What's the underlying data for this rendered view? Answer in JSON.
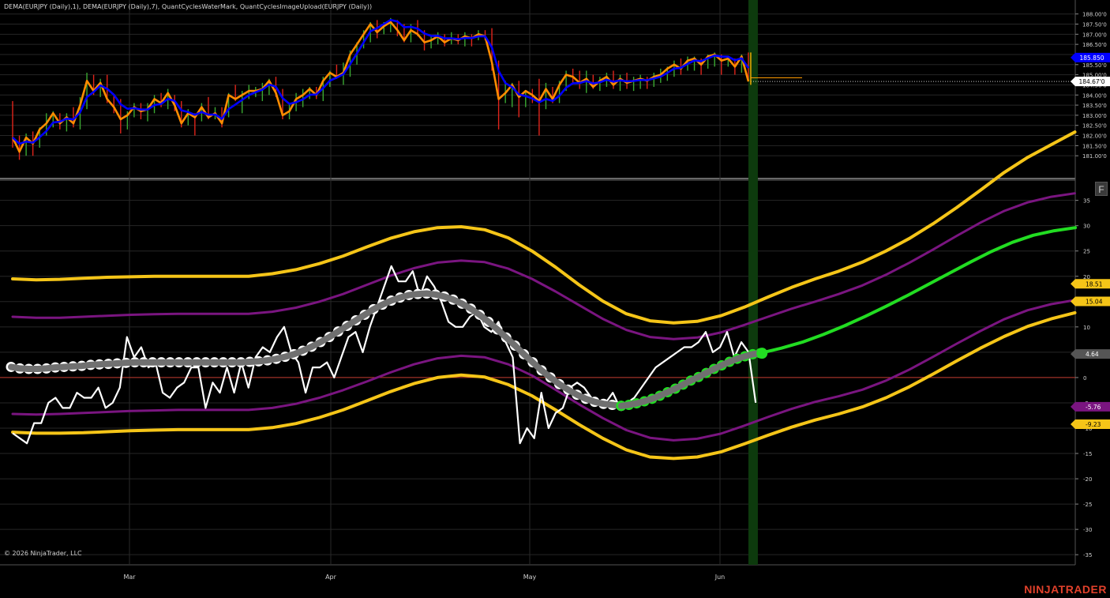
{
  "header": {
    "indicator_label": "DEMA(EURJPY (Daily),1), DEMA(EURJPY (Daily),7), QuantCyclesWaterMark, QuantCyclesImageUpload(EURJPY (Daily))"
  },
  "footer": {
    "copyright": "© 2026 NinjaTrader, LLC",
    "brand": "NINJATRADER",
    "f_button": "F"
  },
  "chart_data": [
    {
      "type": "line",
      "title": "",
      "ylim": [
        180.5,
        188.3
      ],
      "y_ticks": [
        "188.00'0",
        "187.50'0",
        "187.00'0",
        "186.50'0",
        "186.00'0",
        "185.50'0",
        "185.00'0",
        "184.50'0",
        "184.00'0",
        "183.50'0",
        "183.00'0",
        "182.50'0",
        "182.00'0",
        "181.50'0",
        "181.00'0"
      ],
      "x_ticks": [
        "Mar",
        "Apr",
        "May",
        "Jun"
      ],
      "price_bars": [
        [
          183.7,
          181.4,
          183.6,
          181.9
        ],
        [
          182.0,
          180.8,
          181.9,
          181.2
        ],
        [
          182.1,
          181.0,
          181.3,
          181.9
        ],
        [
          182.2,
          181.0,
          181.8,
          181.6
        ],
        [
          182.4,
          181.4,
          181.6,
          182.3
        ],
        [
          183.1,
          182.0,
          182.3,
          182.6
        ],
        [
          183.2,
          182.4,
          182.6,
          183.1
        ],
        [
          183.1,
          182.3,
          183.0,
          182.6
        ],
        [
          183.1,
          182.2,
          182.6,
          182.9
        ],
        [
          183.4,
          182.4,
          182.9,
          182.6
        ],
        [
          183.9,
          182.3,
          182.6,
          183.5
        ],
        [
          185.1,
          183.3,
          183.5,
          184.7
        ],
        [
          185.0,
          184.0,
          184.6,
          184.2
        ],
        [
          184.8,
          183.9,
          184.2,
          184.6
        ],
        [
          185.0,
          183.6,
          184.6,
          183.8
        ],
        [
          184.0,
          183.1,
          183.8,
          183.4
        ],
        [
          183.8,
          182.1,
          183.3,
          182.8
        ],
        [
          183.2,
          182.3,
          182.8,
          183.0
        ],
        [
          183.6,
          182.9,
          183.0,
          183.4
        ],
        [
          183.6,
          182.8,
          183.4,
          183.2
        ],
        [
          183.6,
          182.7,
          183.2,
          183.3
        ],
        [
          184.0,
          183.1,
          183.3,
          183.8
        ],
        [
          184.1,
          183.4,
          183.8,
          183.6
        ],
        [
          184.3,
          183.3,
          183.6,
          184.1
        ],
        [
          184.0,
          183.2,
          184.1,
          183.5
        ],
        [
          183.7,
          182.4,
          183.6,
          182.6
        ],
        [
          183.3,
          182.5,
          182.7,
          183.1
        ],
        [
          183.1,
          182.0,
          183.0,
          182.9
        ],
        [
          183.6,
          182.7,
          182.9,
          183.4
        ],
        [
          183.9,
          182.8,
          183.4,
          182.9
        ],
        [
          183.4,
          182.8,
          183.0,
          183.1
        ],
        [
          183.4,
          182.4,
          183.1,
          182.6
        ],
        [
          184.1,
          182.9,
          182.7,
          184.0
        ],
        [
          184.5,
          183.7,
          184.0,
          183.8
        ],
        [
          184.2,
          183.1,
          183.8,
          184.0
        ],
        [
          184.5,
          183.8,
          184.0,
          184.2
        ],
        [
          184.4,
          183.9,
          184.2,
          184.2
        ],
        [
          184.6,
          183.7,
          184.2,
          184.3
        ],
        [
          184.8,
          184.0,
          184.3,
          184.7
        ],
        [
          184.9,
          183.9,
          184.7,
          184.1
        ],
        [
          184.3,
          182.8,
          184.1,
          183.0
        ],
        [
          183.6,
          182.8,
          183.1,
          183.2
        ],
        [
          184.1,
          183.2,
          183.2,
          183.8
        ],
        [
          184.3,
          183.4,
          183.8,
          184.0
        ],
        [
          184.4,
          183.8,
          184.0,
          184.3
        ],
        [
          184.4,
          183.8,
          184.2,
          184.0
        ],
        [
          184.9,
          183.7,
          184.0,
          184.7
        ],
        [
          185.2,
          184.4,
          184.7,
          185.1
        ],
        [
          185.5,
          184.8,
          185.1,
          184.9
        ],
        [
          185.6,
          184.5,
          184.9,
          185.1
        ],
        [
          186.2,
          184.9,
          185.2,
          186.0
        ],
        [
          186.6,
          185.5,
          186.0,
          186.5
        ],
        [
          187.2,
          186.3,
          186.5,
          187.0
        ],
        [
          187.6,
          186.6,
          187.0,
          187.5
        ],
        [
          187.7,
          186.8,
          187.4,
          187.1
        ],
        [
          187.6,
          187.0,
          187.1,
          187.4
        ],
        [
          187.8,
          187.1,
          187.3,
          187.6
        ],
        [
          187.7,
          186.9,
          187.6,
          187.2
        ],
        [
          187.5,
          186.6,
          187.2,
          186.7
        ],
        [
          187.5,
          186.6,
          186.8,
          187.2
        ],
        [
          187.7,
          186.9,
          187.2,
          187.0
        ],
        [
          187.2,
          186.2,
          187.0,
          186.6
        ],
        [
          186.9,
          186.3,
          186.6,
          186.7
        ],
        [
          187.1,
          186.5,
          186.7,
          186.9
        ],
        [
          187.0,
          186.4,
          186.9,
          186.6
        ],
        [
          187.1,
          186.5,
          186.6,
          186.8
        ],
        [
          187.0,
          186.5,
          186.8,
          186.7
        ],
        [
          187.1,
          186.4,
          186.7,
          186.9
        ],
        [
          187.0,
          186.4,
          186.9,
          186.8
        ],
        [
          187.2,
          186.7,
          186.8,
          187.0
        ],
        [
          187.2,
          186.7,
          187.0,
          186.9
        ],
        [
          187.3,
          185.2,
          186.9,
          185.6
        ],
        [
          185.7,
          182.3,
          185.4,
          183.8
        ],
        [
          184.7,
          183.6,
          183.8,
          184.1
        ],
        [
          184.6,
          183.4,
          184.1,
          184.5
        ],
        [
          184.7,
          182.9,
          184.5,
          183.9
        ],
        [
          184.2,
          183.4,
          183.8,
          184.2
        ],
        [
          184.3,
          183.6,
          184.2,
          184.0
        ],
        [
          184.8,
          182.0,
          184.0,
          183.7
        ],
        [
          184.6,
          183.3,
          183.7,
          184.3
        ],
        [
          184.4,
          183.6,
          184.3,
          183.8
        ],
        [
          184.7,
          183.6,
          183.9,
          184.5
        ],
        [
          185.2,
          184.2,
          184.5,
          185.0
        ],
        [
          185.3,
          184.6,
          185.0,
          184.9
        ],
        [
          185.2,
          184.3,
          184.9,
          184.6
        ],
        [
          185.2,
          184.1,
          184.6,
          184.8
        ],
        [
          185.0,
          184.3,
          184.8,
          184.4
        ],
        [
          184.9,
          184.2,
          184.4,
          184.7
        ],
        [
          185.1,
          184.4,
          184.7,
          184.9
        ],
        [
          185.2,
          184.3,
          184.9,
          184.5
        ],
        [
          185.0,
          184.2,
          184.5,
          184.8
        ],
        [
          185.1,
          184.3,
          184.8,
          184.6
        ],
        [
          184.9,
          184.2,
          184.6,
          184.7
        ],
        [
          185.0,
          184.3,
          184.7,
          184.8
        ],
        [
          184.9,
          184.3,
          184.8,
          184.7
        ],
        [
          185.1,
          184.4,
          184.7,
          184.9
        ],
        [
          185.3,
          184.6,
          184.9,
          185.0
        ],
        [
          185.4,
          184.7,
          185.0,
          185.3
        ],
        [
          185.7,
          184.9,
          185.3,
          185.5
        ],
        [
          185.8,
          185.0,
          185.5,
          185.3
        ],
        [
          185.9,
          185.2,
          185.3,
          185.7
        ],
        [
          185.9,
          185.2,
          185.7,
          185.8
        ],
        [
          185.8,
          185.0,
          185.8,
          185.5
        ],
        [
          186.0,
          185.3,
          185.5,
          185.9
        ],
        [
          186.1,
          185.4,
          185.9,
          186.0
        ],
        [
          186.0,
          185.0,
          186.0,
          185.7
        ],
        [
          185.9,
          185.4,
          185.6,
          185.8
        ],
        [
          185.8,
          185.0,
          185.8,
          185.4
        ],
        [
          186.0,
          185.1,
          185.4,
          185.9
        ],
        [
          186.1,
          184.67,
          185.9,
          184.67
        ]
      ],
      "series": [
        {
          "name": "DEMA(EURJPY (Daily),1)",
          "color": "#ff8c00",
          "source": "close"
        },
        {
          "name": "DEMA(EURJPY (Daily),7)",
          "color": "#0000ff",
          "period": 7
        }
      ],
      "reference_line": 184.85,
      "price_badges": [
        {
          "label": "185.850",
          "value": 185.85,
          "bg": "#0000ff",
          "fg": "#ffffff"
        },
        {
          "label": "184.67'0",
          "value": 184.67,
          "bg": "#ffffff",
          "fg": "#000000"
        }
      ],
      "colors": {
        "up": "#3aa832",
        "down": "#e0241b"
      }
    },
    {
      "type": "line",
      "title": "",
      "ylim": [
        -37,
        39
      ],
      "y_ticks": [
        35,
        30,
        25,
        20,
        15,
        10,
        5,
        0,
        -5,
        -10,
        -15,
        -20,
        -25,
        -30,
        -35
      ],
      "zero_line": 0,
      "oscillator": [
        -11,
        -12,
        -13,
        -9,
        -9,
        -5,
        -4,
        -6,
        -6,
        -3,
        -4,
        -4,
        -2,
        -6,
        -5,
        -2,
        8,
        4,
        6,
        2,
        3,
        -3,
        -4,
        -2,
        -1,
        2,
        2,
        -6,
        -1,
        -3,
        2,
        -3,
        3,
        -2,
        4,
        6,
        5,
        8,
        10,
        5,
        3,
        -3,
        2,
        2,
        3,
        0,
        4,
        8,
        9,
        5,
        10,
        14,
        18,
        22,
        19,
        19,
        21,
        16,
        20,
        18,
        15,
        11,
        10,
        10,
        12,
        13,
        10,
        9,
        11,
        7,
        4,
        -13,
        -10,
        -12,
        -3,
        -10,
        -7,
        -6,
        -2,
        -1,
        -2,
        -4,
        -5,
        -5,
        -3,
        -6,
        -5,
        -4,
        -2,
        0,
        2,
        3,
        4,
        5,
        6,
        6,
        7,
        9,
        5,
        6,
        9,
        4,
        7,
        5,
        -5
      ],
      "cycle_past": [
        2.1,
        1.8,
        1.7,
        1.7,
        1.8,
        2.0,
        2.1,
        2.2,
        2.3,
        2.5,
        2.6,
        2.7,
        2.8,
        2.9,
        3.0,
        3.0,
        3.0,
        3.0,
        3.0,
        3.0,
        3.0,
        3.0,
        3.0,
        3.0,
        3.0,
        3.0,
        3.0,
        3.1,
        3.2,
        3.4,
        3.7,
        4.1,
        4.6,
        5.3,
        6.1,
        7.0,
        8.0,
        9.1,
        10.2,
        11.3,
        12.4,
        13.5,
        14.4,
        15.2,
        15.8,
        16.3,
        16.5,
        16.6,
        16.4,
        16.0,
        15.4,
        14.6,
        13.6,
        12.4,
        11.0,
        9.5,
        7.9,
        6.3,
        4.6,
        3.0,
        1.4,
        0.0,
        -1.3,
        -2.4,
        -3.4,
        -4.2,
        -4.8,
        -5.2,
        -5.4,
        -5.6
      ],
      "cycle_confirm": [
        -5.6,
        -5.4,
        -5.1,
        -4.7,
        -4.2,
        -3.6,
        -2.9,
        -2.2,
        -1.4,
        -0.6,
        0.1,
        0.9,
        1.7,
        2.4,
        3.1,
        3.7,
        4.2,
        4.6,
        4.8
      ],
      "cycle_projection": [
        4.8,
        5.8,
        7.0,
        8.5,
        10.2,
        12.1,
        14.1,
        16.2,
        18.4,
        20.6,
        22.8,
        24.9,
        26.7,
        28.1,
        29.0,
        29.6
      ],
      "bands": [
        {
          "name": "upper-outer",
          "color": "#f5c518",
          "points": [
            19.5,
            19.3,
            19.4,
            19.6,
            19.8,
            19.9,
            20.0,
            20.0,
            20.0,
            20.0,
            20.0,
            20.5,
            21.3,
            22.5,
            24.0,
            25.8,
            27.5,
            28.8,
            29.6,
            29.8,
            29.2,
            27.6,
            25.0,
            21.8,
            18.3,
            15.1,
            12.6,
            11.2,
            10.8,
            11.1,
            12.2,
            13.9,
            15.9,
            17.8,
            19.5,
            21.0,
            22.8,
            25.0,
            27.5,
            30.4,
            33.6,
            37.0,
            40.5,
            43.5,
            46.0,
            48.5
          ]
        },
        {
          "name": "upper-inner",
          "color": "#7a1580",
          "points": [
            12.0,
            11.8,
            11.8,
            12.0,
            12.2,
            12.4,
            12.5,
            12.6,
            12.6,
            12.6,
            12.6,
            13.0,
            13.8,
            15.0,
            16.5,
            18.3,
            20.1,
            21.6,
            22.7,
            23.1,
            22.8,
            21.5,
            19.5,
            17.0,
            14.3,
            11.6,
            9.4,
            8.0,
            7.6,
            7.9,
            8.9,
            10.4,
            12.0,
            13.6,
            15.0,
            16.5,
            18.2,
            20.3,
            22.7,
            25.3,
            28.0,
            30.6,
            32.9,
            34.6,
            35.7,
            36.4
          ]
        },
        {
          "name": "lower-inner",
          "color": "#7a1580",
          "points": [
            -7.2,
            -7.3,
            -7.2,
            -7.0,
            -6.8,
            -6.6,
            -6.5,
            -6.4,
            -6.4,
            -6.4,
            -6.4,
            -6.0,
            -5.2,
            -4.0,
            -2.5,
            -0.8,
            1.0,
            2.6,
            3.8,
            4.3,
            4.0,
            2.6,
            0.4,
            -2.4,
            -5.3,
            -8.0,
            -10.4,
            -11.9,
            -12.4,
            -12.1,
            -11.1,
            -9.5,
            -7.8,
            -6.2,
            -4.8,
            -3.7,
            -2.4,
            -0.6,
            1.6,
            4.1,
            6.7,
            9.2,
            11.5,
            13.3,
            14.5,
            15.3
          ]
        },
        {
          "name": "lower-outer",
          "color": "#f5c518",
          "points": [
            -10.8,
            -11.0,
            -11.0,
            -10.9,
            -10.7,
            -10.5,
            -10.4,
            -10.3,
            -10.3,
            -10.3,
            -10.3,
            -9.9,
            -9.1,
            -7.9,
            -6.4,
            -4.6,
            -2.8,
            -1.2,
            0.0,
            0.5,
            0.1,
            -1.4,
            -3.6,
            -6.4,
            -9.3,
            -12.0,
            -14.3,
            -15.7,
            -16.0,
            -15.7,
            -14.7,
            -13.1,
            -11.4,
            -9.8,
            -8.4,
            -7.2,
            -5.8,
            -4.0,
            -1.8,
            0.7,
            3.3,
            5.8,
            8.1,
            10.1,
            11.6,
            12.8
          ]
        }
      ],
      "value_badges": [
        {
          "label": "18.51",
          "value": 18.51,
          "bg": "#f5c518",
          "fg": "#000000"
        },
        {
          "label": "15.04",
          "value": 15.04,
          "bg": "#f5c518",
          "fg": "#000000"
        },
        {
          "label": "4.64",
          "value": 4.64,
          "bg": "#555555",
          "fg": "#ffffff"
        },
        {
          "label": "-5.76",
          "value": -5.76,
          "bg": "#7a1580",
          "fg": "#ffffff"
        },
        {
          "label": "-9.23",
          "value": -9.23,
          "bg": "#f5c518",
          "fg": "#000000"
        }
      ],
      "colors": {
        "oscillator": "#ffffff",
        "cycle": "#707070",
        "cycle_dots": "#ffffff",
        "confirm_dots": "#22dd22",
        "projection": "#22dd22",
        "zero": "#c0392b",
        "marker": "#0d3a0d"
      }
    }
  ]
}
